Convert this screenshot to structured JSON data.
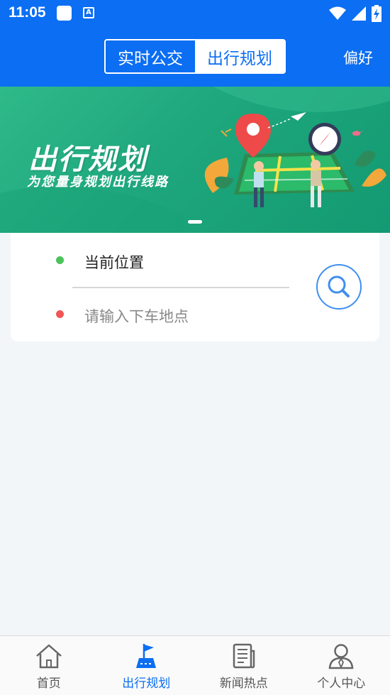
{
  "status_bar": {
    "time": "11:05",
    "icons": [
      "square-icon",
      "a-badge-icon",
      "wifi-icon",
      "signal-icon",
      "battery-charging-icon"
    ],
    "a_badge": "A"
  },
  "header": {
    "tabs": [
      {
        "label": "实时公交",
        "active": false
      },
      {
        "label": "出行规划",
        "active": true
      }
    ],
    "pref_label": "偏好"
  },
  "banner": {
    "title": "出行规划",
    "subtitle": "为您量身规划出行线路",
    "colors": {
      "green": "#1ea67c"
    }
  },
  "route": {
    "origin": "当前位置",
    "destination_placeholder": "请输入下车地点",
    "origin_dot_color": "#4cc35a",
    "dest_dot_color": "#f05655"
  },
  "bottom_nav": {
    "items": [
      {
        "label": "首页",
        "icon": "home-icon",
        "active": false
      },
      {
        "label": "出行规划",
        "icon": "route-flag-icon",
        "active": true
      },
      {
        "label": "新闻热点",
        "icon": "news-icon",
        "active": false
      },
      {
        "label": "个人中心",
        "icon": "user-icon",
        "active": false
      }
    ]
  },
  "colors": {
    "primary": "#0b6ef3",
    "background": "#f3f6f8"
  }
}
